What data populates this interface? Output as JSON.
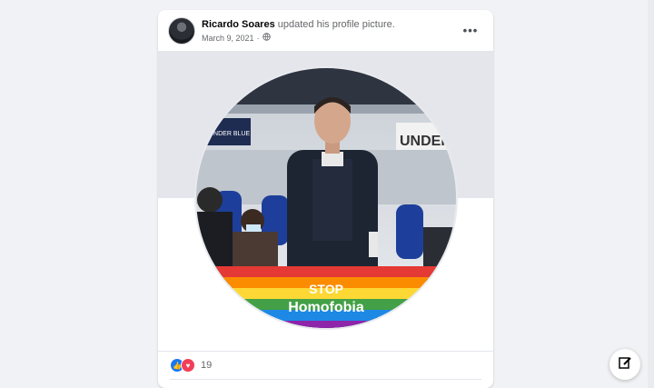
{
  "post": {
    "author": "Ricardo Soares",
    "action": " updated his profile picture.",
    "date": "March 9, 2021",
    "audience_icon": "globe-icon",
    "more_icon": "more-options-icon",
    "more_label": "•••"
  },
  "photo": {
    "banner_line1": "STOP",
    "banner_line2": "Homofobia",
    "sign_left": "UNDER BLUE",
    "sign_right": "UNDER",
    "rainbow_colors": [
      "#e53935",
      "#fb8c00",
      "#fdd835",
      "#43a047",
      "#1e88e5",
      "#8e24aa"
    ]
  },
  "reactions": {
    "count": "19",
    "icons": [
      "like-icon",
      "love-icon"
    ]
  },
  "compose": {
    "icon": "compose-icon"
  }
}
